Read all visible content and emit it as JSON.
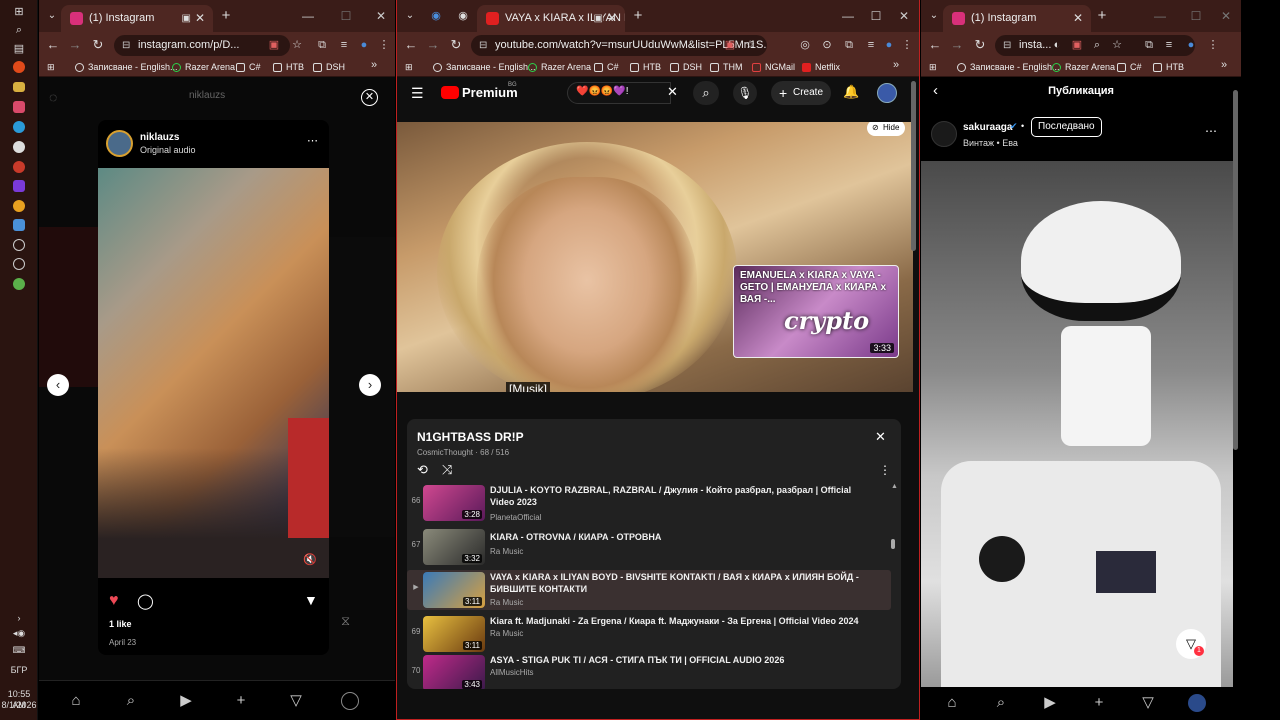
{
  "taskbar": {
    "language": "БГР",
    "time": "10:55 AM",
    "date": "8/1/2026"
  },
  "left_window": {
    "tab_title": "(1) Instagram",
    "url": "instagram.com/p/D...",
    "bookmarks": [
      "Записване - English...",
      "Razer Arena",
      "C#",
      "HTB",
      "DSH"
    ],
    "ig": {
      "header_user": "niklauzs",
      "post_user": "niklauzs",
      "post_audio": "Original audio",
      "likes": "1 like",
      "date": "April 23"
    }
  },
  "mid_window": {
    "tab_title": "VAYA x KIARA x ILIYAN BOYD",
    "url": "youtube.com/watch?v=msurUUduWwM&list=PL5Mn1S...",
    "bookmarks": [
      "Записване - English...",
      "Razer Arena",
      "C#",
      "HTB",
      "DSH",
      "THM",
      "NGMail",
      "Netflix"
    ],
    "yt": {
      "logo": "Premium",
      "logo_sup": "BG",
      "search_value": "❤️😡😡💜!",
      "create": "Create",
      "hide": "Hide",
      "subtitle": "[Musik]",
      "endcard_title": "EMANUELA x KIARA x VAYA - GETO | ЕМАНУЕЛА x КИАРА x ВАЯ -...",
      "endcard_overlay": "crypto",
      "endcard_duration": "3:33",
      "playlist_title": "N1GHTBASS DR!P",
      "playlist_sub": "CosmicThought · 68 / 516",
      "items": [
        {
          "num": "66",
          "title": "DJULIA - KOYTO RAZBRAL, RAZBRAL / Джулия - Който разбрал, разбрал | Official Video 2023",
          "channel": "PlanetaOfficial",
          "duration": "3:28",
          "color": "#b03070"
        },
        {
          "num": "67",
          "title": "KIARA - OTROVNA / КИАРА - ОТРОВНА",
          "channel": "Ra Music",
          "duration": "3:32",
          "color": "#6a6a5a"
        },
        {
          "num": "",
          "title": "VAYA x KIARA x ILIYAN BOYD - BIVSHITE KONTAKTI / ВАЯ x КИАРА x ИЛИЯН БОЙД - БИВШИТЕ КОНТАКТИ",
          "channel": "Ra Music",
          "duration": "3:11",
          "color": "#3a6a9a"
        },
        {
          "num": "69",
          "title": "Kiara ft. Madjunaki - Za Ergena / Киара ft. Маджунаки - За Ергена | Official Video 2024",
          "channel": "Ra Music",
          "duration": "3:11",
          "color": "#9a7a20"
        },
        {
          "num": "70",
          "title": "ASYA - STIGA PUK TI / АСЯ - СТИГА ПЪК ТИ | OFFICIAL AUDIO 2026",
          "channel": "AllMusicHits",
          "duration": "3:43",
          "color": "#8a2a6a"
        }
      ]
    }
  },
  "right_window": {
    "tab_title": "(1) Instagram",
    "url": "insta...",
    "bookmarks": [
      "Записване - English...",
      "Razer Arena",
      "C#",
      "HTB"
    ],
    "ig": {
      "title": "Публикация",
      "user": "sakuraaga",
      "follow_state": "Последвано",
      "audio": "Винтаж • Ева"
    }
  }
}
